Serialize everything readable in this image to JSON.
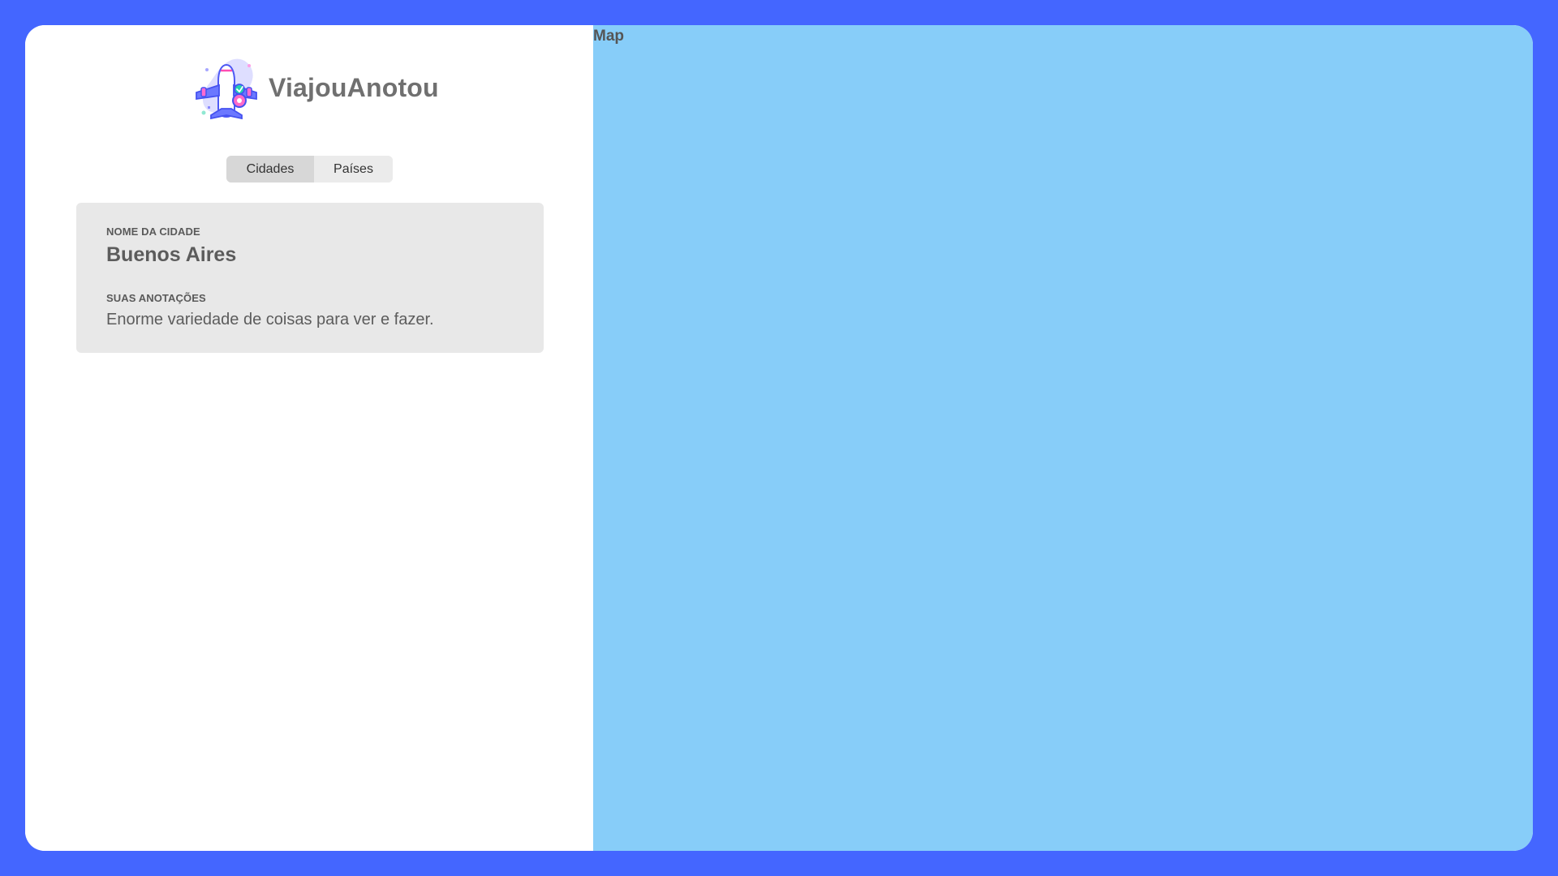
{
  "app": {
    "brand_name": "ViajouAnotou",
    "logo_icon": "airplane-pin-icon"
  },
  "tabs": {
    "items": [
      {
        "label": "Cidades",
        "active": true
      },
      {
        "label": "Países",
        "active": false
      }
    ]
  },
  "city_card": {
    "name_label": "NOME DA CIDADE",
    "name_value": "Buenos Aires",
    "notes_label": "SUAS ANOTAÇÕES",
    "notes_value": "Enorme variedade de coisas para ver e fazer."
  },
  "map": {
    "title": "Map"
  },
  "colors": {
    "background": "#4466ff",
    "map": "#87cdf9",
    "card": "#e8e8e8",
    "tab_active": "#d7d7d7",
    "tab_inactive": "#ebebeb"
  }
}
